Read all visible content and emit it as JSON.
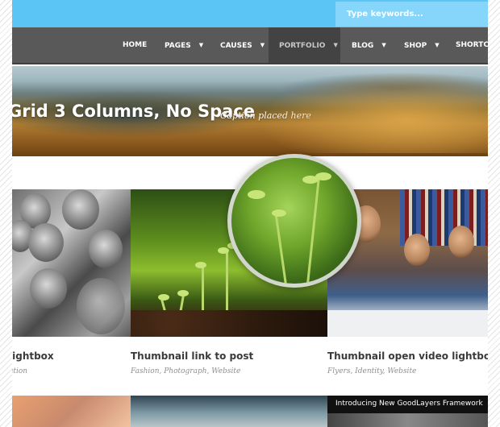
{
  "search": {
    "placeholder": "Type keywords..."
  },
  "nav": {
    "items": [
      {
        "label": "HOME",
        "dropdown": false,
        "active": false
      },
      {
        "label": "PAGES",
        "dropdown": true,
        "active": false
      },
      {
        "label": "CAUSES",
        "dropdown": true,
        "active": false
      },
      {
        "label": "PORTFOLIO",
        "dropdown": true,
        "active": true
      },
      {
        "label": "BLOG",
        "dropdown": true,
        "active": false
      },
      {
        "label": "SHOP",
        "dropdown": true,
        "active": false
      },
      {
        "label": "SHORTCO",
        "dropdown": false,
        "active": false
      }
    ],
    "caret": "▼"
  },
  "hero": {
    "title": "Grid 3 Columns, No Space",
    "caption": "Caption placed here"
  },
  "portfolio": [
    {
      "title": "lightbox",
      "tags": "ation"
    },
    {
      "title": "Thumbnail link to post",
      "tags": "Fashion, Photograph, Website"
    },
    {
      "title": "Thumbnail open video lightbox",
      "tags": "Flyers, Identity, Website"
    }
  ],
  "bottom_row": {
    "third_caption": "Introducing New GoodLayers Framework"
  },
  "colors": {
    "topbar": "#5bc5f6",
    "search_bg": "#86d6fb",
    "nav_bg": "#595959",
    "nav_active": "#434343",
    "title_text": "#3a3a3a",
    "tag_text": "#8f8f8f"
  }
}
